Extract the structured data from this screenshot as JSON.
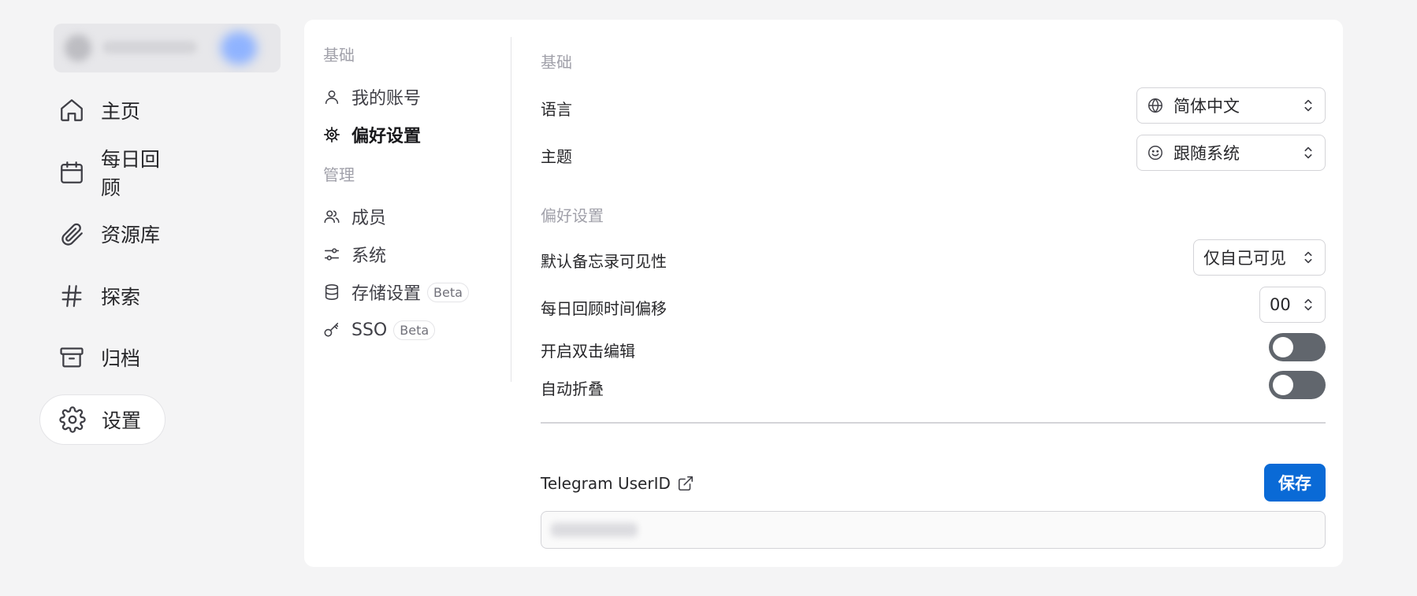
{
  "sidebar": {
    "items": [
      {
        "label": "主页",
        "icon": "home-icon"
      },
      {
        "label": "每日回顾",
        "icon": "calendar-icon"
      },
      {
        "label": "资源库",
        "icon": "paperclip-icon"
      },
      {
        "label": "探索",
        "icon": "hash-icon"
      },
      {
        "label": "归档",
        "icon": "archive-icon"
      },
      {
        "label": "设置",
        "icon": "gear-icon",
        "active": true
      }
    ]
  },
  "settings_nav": {
    "basic_title": "基础",
    "my_account": "我的账号",
    "preferences": "偏好设置",
    "admin_title": "管理",
    "members": "成员",
    "system": "系统",
    "storage": "存储设置",
    "storage_badge": "Beta",
    "sso": "SSO",
    "sso_badge": "Beta"
  },
  "basic": {
    "title": "基础",
    "language_label": "语言",
    "language_value": "简体中文",
    "theme_label": "主题",
    "theme_value": "跟随系统"
  },
  "prefs": {
    "title": "偏好设置",
    "visibility_label": "默认备忘录可见性",
    "visibility_value": "仅自己可见",
    "offset_label": "每日回顾时间偏移",
    "offset_value": "00",
    "dblclick_label": "开启双击编辑",
    "dblclick_enabled": false,
    "autocollapse_label": "自动折叠",
    "autocollapse_enabled": false
  },
  "telegram": {
    "label": "Telegram UserID",
    "save_label": "保存"
  },
  "colors": {
    "accent": "#0a6ad6",
    "toggle_off": "#61666d",
    "page_bg": "#f4f4f5"
  }
}
